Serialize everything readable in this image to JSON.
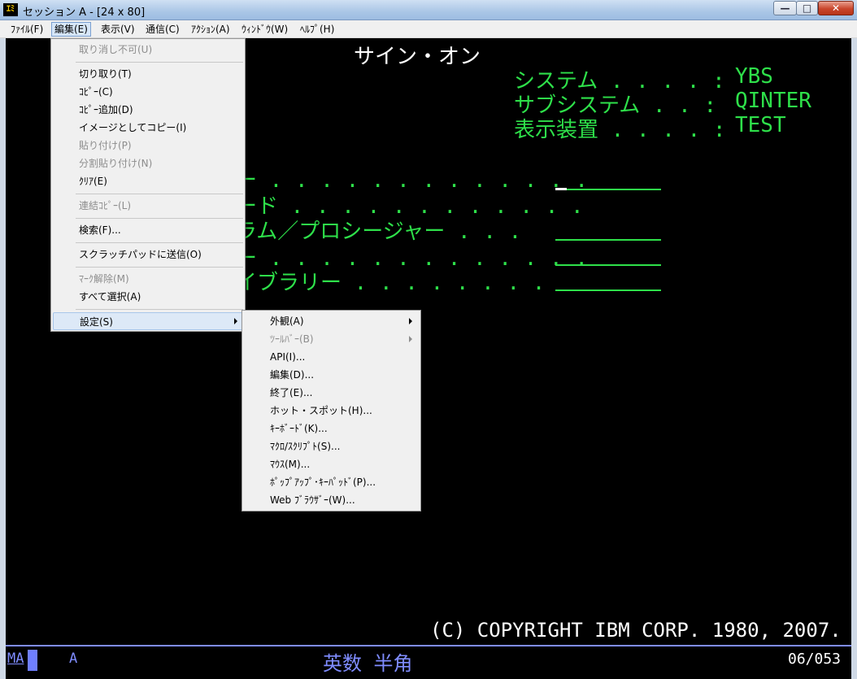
{
  "window": {
    "icon_glyph": "ｴﾐ",
    "title": "セッション A - [24 x 80]",
    "min_glyph": "—",
    "max_glyph": "□",
    "close_glyph": "✕"
  },
  "menubar": [
    {
      "id": "file",
      "label": "ﾌｧｲﾙ(F)"
    },
    {
      "id": "edit",
      "label": "編集(E)"
    },
    {
      "id": "view",
      "label": "表示(V)"
    },
    {
      "id": "comm",
      "label": "通信(C)"
    },
    {
      "id": "action",
      "label": "ｱｸｼｮﾝ(A)"
    },
    {
      "id": "window",
      "label": "ｳｨﾝﾄﾞｳ(W)"
    },
    {
      "id": "help",
      "label": "ﾍﾙﾌﾟ(H)"
    }
  ],
  "edit_menu": {
    "undo": "取り消し不可(U)",
    "cut": "切り取り(T)",
    "copy": "ｺﾋﾟｰ(C)",
    "copy_append": "ｺﾋﾟｰ追加(D)",
    "copy_image": "イメージとしてコピー(I)",
    "paste": "貼り付け(P)",
    "paste_split": "分割貼り付け(N)",
    "clear": "ｸﾘｱ(E)",
    "link_copy": "連結ｺﾋﾟｰ(L)",
    "find": "検索(F)...",
    "scratchpad": "スクラッチパッドに送信(O)",
    "unmark": "ﾏｰｸ解除(M)",
    "select_all": "すべて選択(A)",
    "settings": "設定(S)"
  },
  "settings_menu": {
    "appearance": "外観(A)",
    "toolbar": "ﾂｰﾙﾊﾞｰ(B)",
    "api": "API(I)...",
    "edit": "編集(D)...",
    "exit": "終了(E)...",
    "hotspot": "ホット・スポット(H)...",
    "keyboard": "ｷｰﾎﾞｰﾄﾞ(K)...",
    "macro": "ﾏｸﾛ/ｽｸﾘﾌﾟﾄ(S)...",
    "mouse": "ﾏｳｽ(M)...",
    "popup_keypad": "ﾎﾟｯﾌﾟｱｯﾌﾟ･ｷｰﾊﾟｯﾄﾞ(P)...",
    "web_browser": "Web ﾌﾞﾗｳｻﾞｰ(W)..."
  },
  "screen": {
    "title": "サイン・オン",
    "system_label": "システム . . . . :",
    "system_value": "YBS",
    "subsystem_label": "サブシステム . . :",
    "subsystem_value": "QINTER",
    "display_label": "表示装置 . . . . :",
    "display_value": "TEST",
    "field1": "ー . . . . . . . . . . . . .",
    "field2": "ード . . . . . . . . . . . .",
    "field3": "ラム／プロシージャー . . .",
    "field4": "ー . . . . . . . . . . . . .",
    "field5": "イブラリー . . . . . . . .",
    "copyright": "(C) COPYRIGHT IBM CORP. 1980, 2007."
  },
  "status": {
    "ma": "MA",
    "mode_a": "A",
    "ime": "英数 半角",
    "position": "06/053"
  },
  "colors": {
    "terminal_green": "#2ee04a",
    "terminal_white": "#ffffff",
    "terminal_blue": "#7f8cff"
  }
}
